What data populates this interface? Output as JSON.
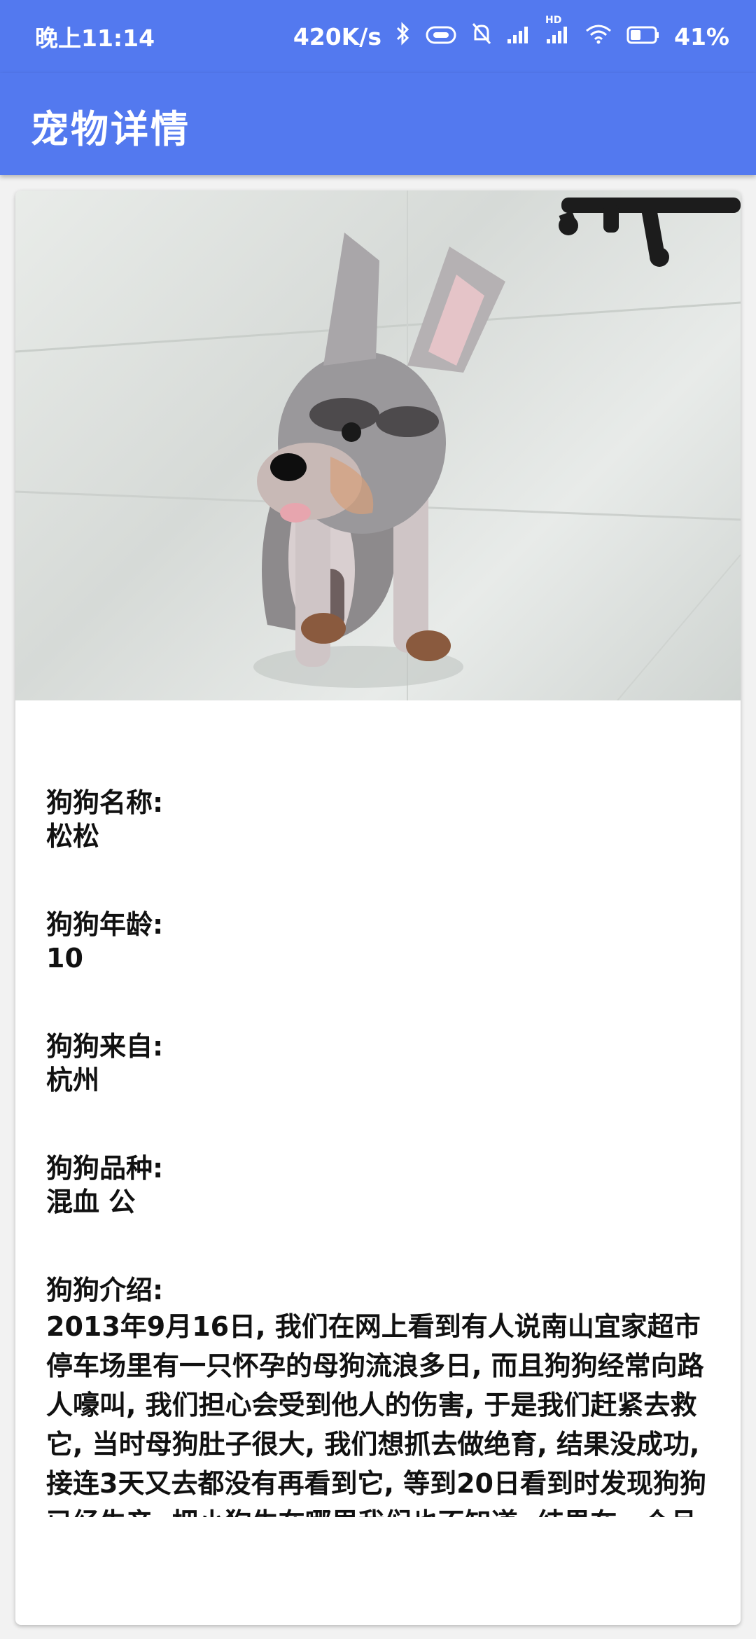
{
  "status_bar": {
    "time": "晚上11:14",
    "network_speed": "420K/s",
    "battery": "41%",
    "hd_label": "HD"
  },
  "app_bar": {
    "title": "宠物详情"
  },
  "pet": {
    "image_alt": "schnauzer dog photo",
    "fields": [
      {
        "label": "狗狗名称:",
        "value": "松松"
      },
      {
        "label": "狗狗年龄:",
        "value": "10"
      },
      {
        "label": "狗狗来自:",
        "value": "杭州"
      },
      {
        "label": "狗狗品种:",
        "value": "混血 公"
      }
    ],
    "intro_label": "狗狗介绍:",
    "intro_text": "2013年9月16日, 我们在网上看到有人说南山宜家超市停车场里有一只怀孕的母狗流浪多日, 而且狗狗经常向路人嚎叫, 我们担心会受到他人的伤害, 于是我们赶紧去救它, 当时母狗肚子很大, 我们想抓去做绝育, 结果没成功, 接连3天又去都没有再看到它, 等到20日看到时发现狗狗已经生产, 把小狗生在哪里我们也不知道, 结果在一个月里, 我"
  }
}
